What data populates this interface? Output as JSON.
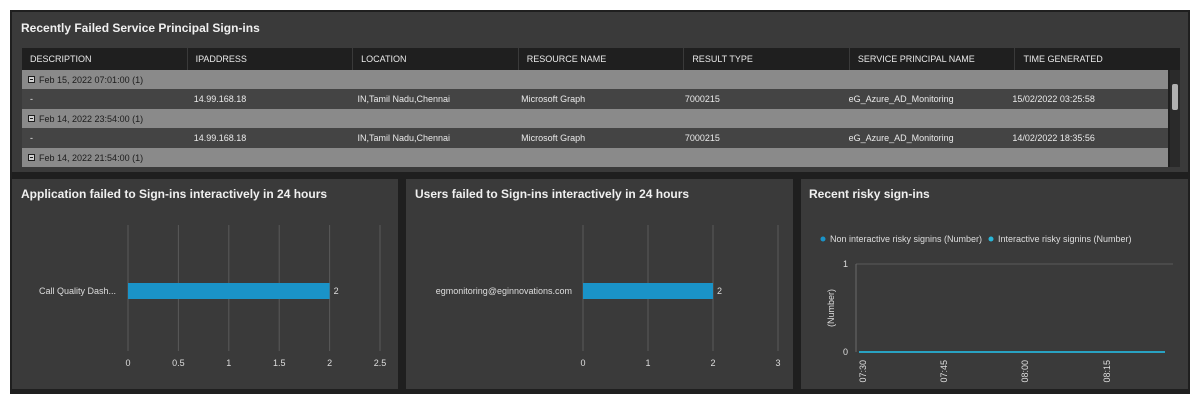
{
  "table_panel": {
    "title": "Recently Failed Service Principal Sign-ins",
    "columns": [
      "DESCRIPTION",
      "IPADDRESS",
      "LOCATION",
      "RESOURCE NAME",
      "RESULT TYPE",
      "SERVICE PRINCIPAL NAME",
      "TIME GENERATED"
    ],
    "groups": [
      {
        "label": "Feb 15, 2022 07:01:00 (1)",
        "rows": [
          [
            "-",
            "14.99.168.18",
            "IN,Tamil Nadu,Chennai",
            "Microsoft Graph",
            "7000215",
            "eG_Azure_AD_Monitoring",
            "15/02/2022 03:25:58"
          ]
        ]
      },
      {
        "label": "Feb 14, 2022 23:54:00 (1)",
        "rows": [
          [
            "-",
            "14.99.168.18",
            "IN,Tamil Nadu,Chennai",
            "Microsoft Graph",
            "7000215",
            "eG_Azure_AD_Monitoring",
            "14/02/2022 18:35:56"
          ]
        ]
      },
      {
        "label": "Feb 14, 2022 21:54:00 (1)",
        "rows": []
      }
    ]
  },
  "app_panel": {
    "title": "Application failed to Sign-ins interactively in 24 hours",
    "chart_data": {
      "type": "bar",
      "orientation": "horizontal",
      "categories": [
        "Call Quality Dash..."
      ],
      "values": [
        2
      ],
      "value_labels": [
        "2"
      ],
      "xlim": [
        0,
        2.5
      ],
      "xticks": [
        "0",
        "0.5",
        "1",
        "1.5",
        "2",
        "2.5"
      ],
      "grid": true
    }
  },
  "users_panel": {
    "title": "Users failed to Sign-ins interactively in 24 hours",
    "chart_data": {
      "type": "bar",
      "orientation": "horizontal",
      "categories": [
        "egmonitoring@eginnovations.com"
      ],
      "values": [
        2
      ],
      "value_labels": [
        "2"
      ],
      "xlim": [
        0,
        3
      ],
      "xticks": [
        "0",
        "1",
        "2",
        "3"
      ],
      "grid": true
    }
  },
  "risky_panel": {
    "title": "Recent risky sign-ins",
    "chart_data": {
      "type": "line",
      "legend_placement": "top",
      "series": [
        {
          "name": "Non interactive risky signins (Number)",
          "color": "#1a93c8",
          "values": [
            0,
            0,
            0,
            0
          ]
        },
        {
          "name": "Interactive risky signins (Number)",
          "color": "#29b6d8",
          "values": [
            0,
            0,
            0,
            0
          ]
        }
      ],
      "x": [
        "07:30",
        "07:45",
        "08:00",
        "08:15"
      ],
      "ylabel": "(Number)",
      "yticks": [
        "1",
        "0"
      ],
      "ylim": [
        0,
        1
      ]
    }
  }
}
